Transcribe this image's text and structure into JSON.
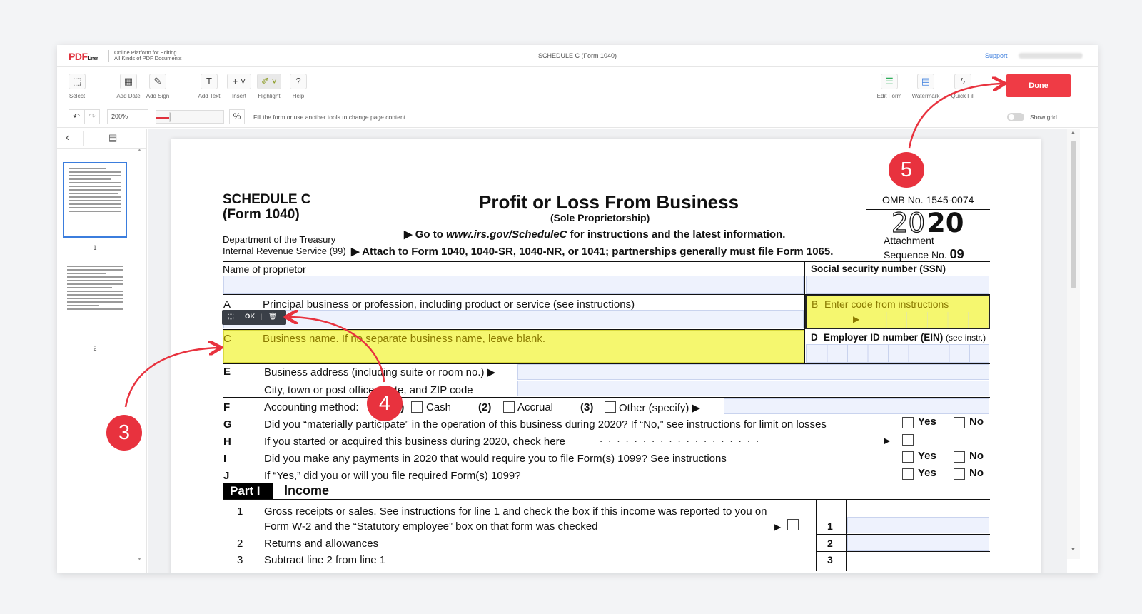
{
  "app": {
    "logo_text": "PDF",
    "logo_sub": "Liner",
    "tagline_line1": "Online Platform for Editing",
    "tagline_line2": "All Kinds of PDF Documents",
    "doc_title": "SCHEDULE C (Form 1040)",
    "support": "Support"
  },
  "toolbar": {
    "select": "Select",
    "add_date": "Add Date",
    "add_sign": "Add Sign",
    "add_text": "Add Text",
    "insert": "Insert",
    "highlight": "Highlight",
    "help": "Help",
    "edit_form": "Edit Form",
    "watermark": "Watermark",
    "quick_fill": "Quick Fill",
    "done": "Done"
  },
  "subbar": {
    "zoom": "200%",
    "hint": "Fill the form or use another tools to change page content",
    "show_grid": "Show grid",
    "zoom_slider_fraction": 0.2
  },
  "sidebar": {
    "pages": [
      "1",
      "2"
    ]
  },
  "popup": {
    "ok": "OK"
  },
  "callouts": {
    "c3": "3",
    "c4": "4",
    "c5": "5"
  },
  "colors": {
    "accent": "#ef3b45",
    "field": "#eef2fd",
    "highlight": "#f5f76f",
    "link": "#3b7ddd"
  },
  "form": {
    "schedule": "SCHEDULE C",
    "form1040": "(Form 1040)",
    "dept1": "Department of the Treasury",
    "dept2": "Internal Revenue Service (99)",
    "title": "Profit or Loss From Business",
    "subtitle": "(Sole Proprietorship)",
    "goto_pre": "▶ Go to ",
    "goto_url": "www.irs.gov/ScheduleC",
    "goto_post": " for instructions and the latest information.",
    "attach": "▶ Attach to Form 1040, 1040-SR, 1040-NR, or 1041; partnerships generally must file Form 1065.",
    "omb": "OMB No. 1545-0074",
    "year_outline": "20",
    "year_bold": "20",
    "attachment": "Attachment",
    "sequence": "Sequence No.",
    "seq_no": "09",
    "name_label": "Name of proprietor",
    "ssn_label": "Social security number (SSN)",
    "a_letter": "A",
    "a_text": "Principal business or profession, including product or service (see instructions)",
    "b_letter": "B",
    "b_text": "Enter code from instructions",
    "c_letter": "C",
    "c_text": "Business name. If no separate business name, leave blank.",
    "d_letter": "D",
    "d_text": "Employer ID number (EIN)",
    "d_small": "(see instr.)",
    "e_letter": "E",
    "e_text1": "Business address (including suite or room no.) ▶",
    "e_text2": "City, town or post office, state, and ZIP code",
    "f_letter": "F",
    "f_text": "Accounting method:",
    "f1": "(1)",
    "f_cash": "Cash",
    "f2": "(2)",
    "f_accrual": "Accrual",
    "f3": "(3)",
    "f_other": "Other (specify) ▶",
    "g_letter": "G",
    "g_text": "Did you “materially participate” in the operation of this business during 2020? If “No,” see instructions for limit on losses",
    "h_letter": "H",
    "h_text": "If you started or acquired this business during 2020, check here",
    "i_letter": "I",
    "i_text": "Did you make any payments in 2020 that would require you to file Form(s) 1099? See instructions",
    "j_letter": "J",
    "j_text": "If “Yes,” did you or will you file required Form(s) 1099?",
    "yes": "Yes",
    "no": "No",
    "part": "Part I",
    "part_title": "Income",
    "l1_num": "1",
    "l1_text1": "Gross receipts or sales. See instructions for line 1 and check the box if this income was reported to you on",
    "l1_text2": "Form W-2 and the “Statutory employee” box on that form was checked",
    "l2_num": "2",
    "l2_text": "Returns and allowances",
    "l3_num": "3",
    "l3_text": "Subtract line 2 from line 1"
  }
}
